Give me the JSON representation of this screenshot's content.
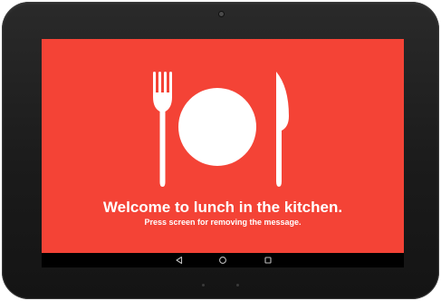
{
  "message": {
    "title": "Welcome to lunch in the kitchen.",
    "subtitle": "Press screen for removing the message."
  },
  "icons": {
    "main": "fork-plate-knife-icon",
    "nav_back": "back-triangle-icon",
    "nav_home": "home-circle-icon",
    "nav_recents": "recents-square-icon"
  },
  "colors": {
    "background": "#f44336",
    "foreground": "#ffffff",
    "nav_bar": "#000000",
    "bezel": "#1b1b1b"
  }
}
